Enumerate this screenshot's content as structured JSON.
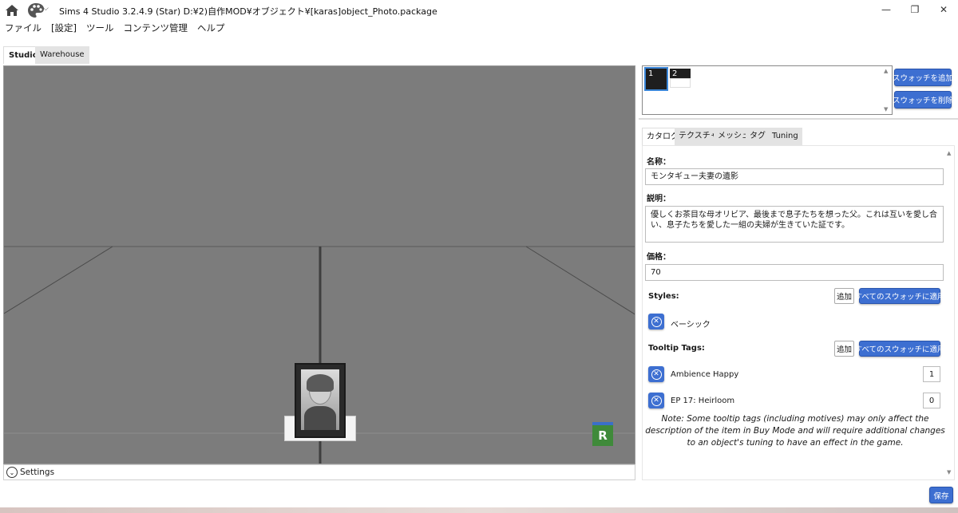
{
  "titlebar": {
    "title": "Sims 4 Studio 3.2.4.9 (Star)  D:¥2)自作MOD¥オブジェクト¥[karas]object_Photo.package",
    "chevron": "⌵",
    "minimize": "—",
    "maximize": "❐",
    "close": "✕"
  },
  "menu": [
    "ファイル",
    "[設定]",
    "ツール",
    "コンテンツ管理",
    "ヘルプ"
  ],
  "main_tabs": [
    "Studio",
    "Warehouse"
  ],
  "viewport": {
    "settings_label": "Settings",
    "settings_chevron": "⌄",
    "badge_letter": "R"
  },
  "swatches": {
    "items": [
      "1",
      "2"
    ],
    "add_label": "スウォッチを追加",
    "remove_label": "スウォッチを削除",
    "scroll_up": "▲",
    "scroll_down": "▼"
  },
  "sub_tabs": [
    "カタログ",
    "テクスチャ",
    "メッシュ",
    "タグ",
    "Tuning"
  ],
  "form": {
    "name_label": "名称：",
    "name_value": "モンタギュー夫妻の遺影",
    "desc_label": "説明：",
    "desc_value": "優しくお茶目な母オリビア、最後まで息子たちを想った父。これは互いを愛し合い、息子たちを愛した一組の夫婦が生きていた証です。",
    "price_label": "価格：",
    "price_value": "70",
    "styles_label": "Styles:",
    "add_label": "追加",
    "apply_all_label": "すべてのスウォッチに適用",
    "styles": [
      {
        "name": "ベーシック"
      }
    ],
    "tooltip_label": "Tooltip Tags:",
    "tags": [
      {
        "name": "Ambience Happy",
        "count": "1"
      },
      {
        "name": "EP 17: Heirloom",
        "count": "0"
      }
    ],
    "remove_glyph": "✕",
    "note": "Note: Some tooltip tags (including motives) may only affect the description of the item in Buy Mode and will require additional changes to an object's tuning to have an effect in the game."
  },
  "save_label": "保存",
  "colors": {
    "accent": "#3d6fd1",
    "viewport_bg": "#7c7c7c",
    "selected_swatch_border": "#3a86d8",
    "badge_green": "#3f8a3a"
  }
}
